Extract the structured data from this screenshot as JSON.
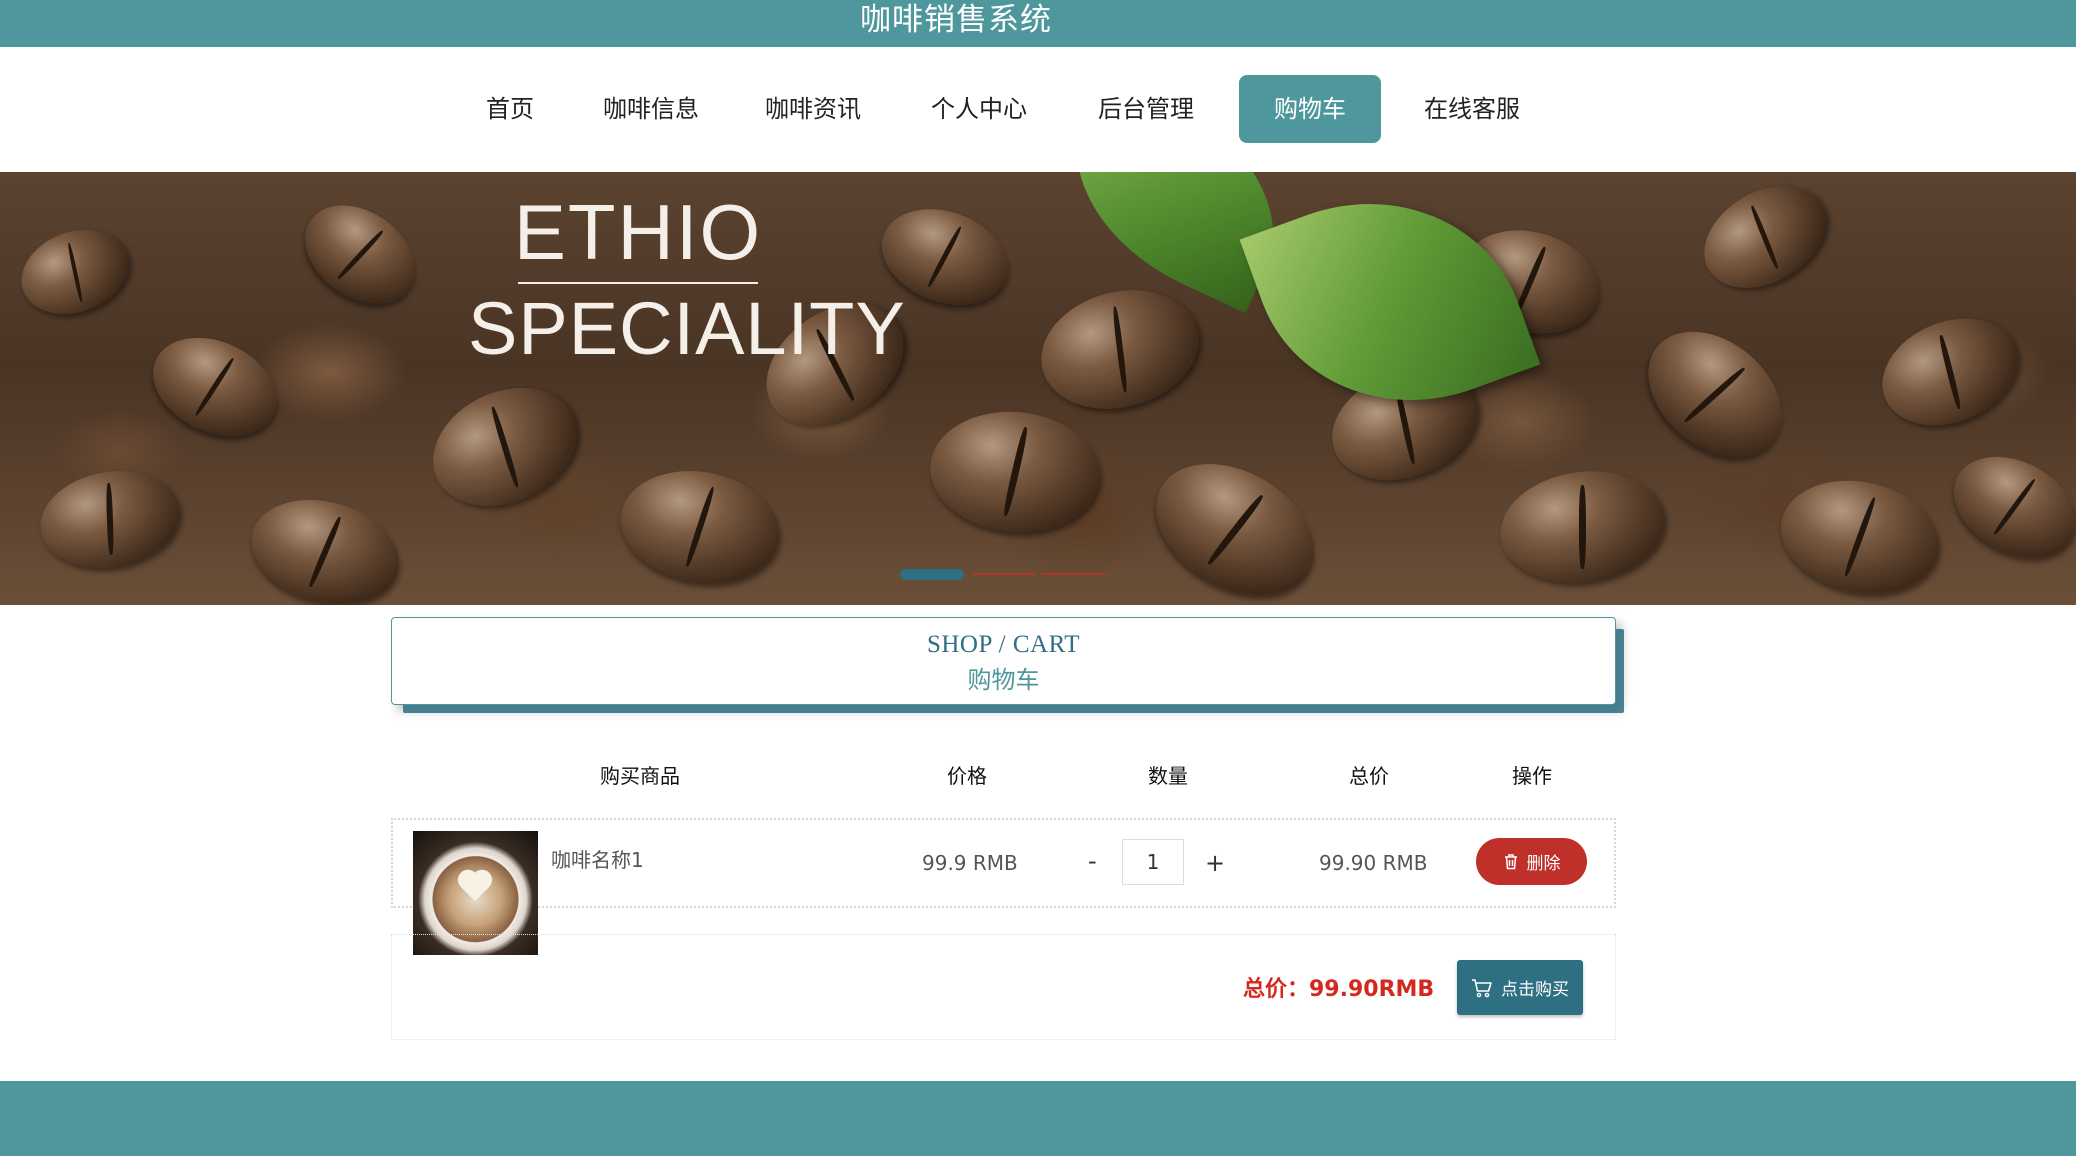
{
  "app": {
    "title": "咖啡销售系统"
  },
  "nav": {
    "items": [
      {
        "label": "首页"
      },
      {
        "label": "咖啡信息"
      },
      {
        "label": "咖啡资讯"
      },
      {
        "label": "个人中心"
      },
      {
        "label": "后台管理"
      },
      {
        "label": "购物车",
        "active": true
      },
      {
        "label": "在线客服"
      }
    ]
  },
  "banner": {
    "line1": "ETHIO",
    "line2": "SPECIALITY",
    "slide_count": 3,
    "active_slide": 1
  },
  "section": {
    "title_en": "SHOP / CART",
    "title_cn": "购物车"
  },
  "table": {
    "headers": [
      "购买商品",
      "价格",
      "数量",
      "总价",
      "操作"
    ],
    "rows": [
      {
        "name": "咖啡名称1",
        "price": "99.9 RMB",
        "quantity": "1",
        "subtotal": "99.90 RMB",
        "action_label": "删除",
        "action_icon": "trash-icon"
      }
    ]
  },
  "qty_controls": {
    "minus": "-",
    "plus": "+"
  },
  "summary": {
    "total": "总价：99.90RMB",
    "buy_label": "点击购买",
    "buy_icon": "cart-icon"
  },
  "colors": {
    "primary": "#4e979d",
    "accent_dark": "#2e6f82",
    "danger": "#c0302a",
    "total_red": "#d4281e"
  }
}
